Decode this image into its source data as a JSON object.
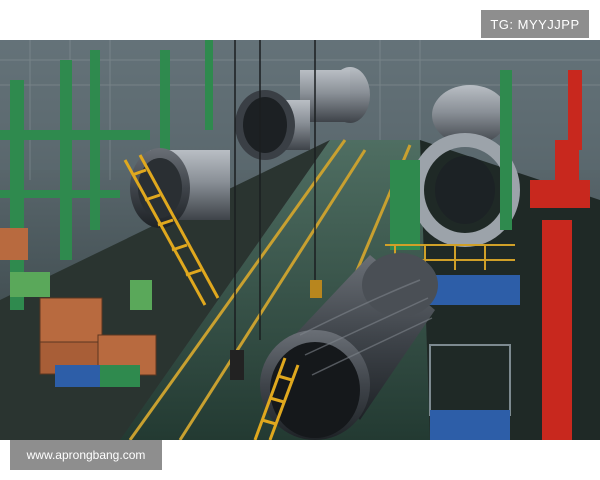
{
  "overlay": {
    "tag_text": "TG: MYYJJPP",
    "site_text": "www.aprongbang.com"
  },
  "photo": {
    "subject": "factory-floor-scene"
  },
  "colors": {
    "frame_green": "#2f8a4e",
    "crane_red": "#c8281e",
    "floor_line": "#c8a030",
    "tank_metal": "#7a7f86",
    "overlay_bg": "#8e8e8e"
  }
}
